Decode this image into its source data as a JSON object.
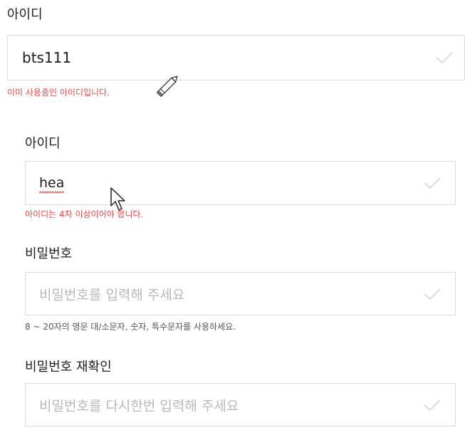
{
  "username_top": {
    "label": "아이디",
    "value": "bts111",
    "error": "이미 사용중인 아이디입니다."
  },
  "username": {
    "label": "아이디",
    "value": "hea",
    "error": "아이디는 4자 이상이어야 합니다."
  },
  "password": {
    "label": "비밀번호",
    "placeholder": "비밀번호를 입력해 주세요",
    "help": "8 ~ 20자의 영문 대/소문자, 숫자, 특수문자를 사용하세요."
  },
  "password_confirm": {
    "label": "비밀번호 재확인",
    "placeholder": "비밀번호를 다시한번 입력해 주세요"
  },
  "icons": {
    "check": "check-icon",
    "pencil": "pencil-cursor-icon",
    "pointer": "arrow-cursor-icon"
  },
  "colors": {
    "error": "#f04646",
    "border": "#dcdcdc",
    "placeholder": "#b9b9b9",
    "check": "#dcdcdc",
    "spellcheck": "#e53935"
  }
}
